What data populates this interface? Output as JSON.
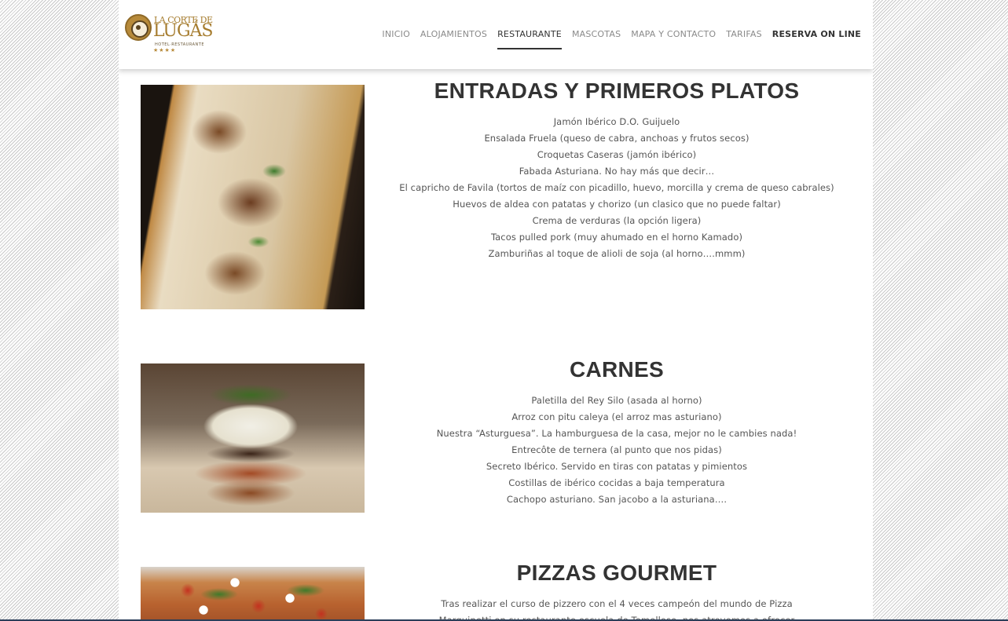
{
  "logo": {
    "line1": "LA CORTE DE",
    "line2": "LUGÁS",
    "line3": "HOTEL·RESTAURANTE",
    "stars": "★★★★"
  },
  "nav": {
    "items": [
      {
        "label": "INICIO"
      },
      {
        "label": "ALOJAMIENTOS"
      },
      {
        "label": "RESTAURANTE"
      },
      {
        "label": "MASCOTAS"
      },
      {
        "label": "MAPA Y CONTACTO"
      },
      {
        "label": "TARIFAS"
      },
      {
        "label": "RESERVA ON LINE"
      }
    ],
    "active": "RESTAURANTE"
  },
  "sections": [
    {
      "title": "ENTRADAS Y PRIMEROS PLATOS",
      "items": [
        "Jamón Ibérico D.O. Guijuelo",
        "Ensalada Fruela (queso de cabra, anchoas y frutos secos)",
        "Croquetas Caseras (jamón ibérico)",
        "Fabada Asturiana. No hay más que decir…",
        "El capricho de Favila (tortos de maíz con picadillo, huevo, morcilla y crema de queso cabrales)",
        "Huevos de aldea con patatas y chorizo (un clasico que no puede faltar)",
        "Crema de verduras (la opción ligera)",
        "Tacos pulled pork (muy ahumado en el horno Kamado)",
        "Zamburiñas al toque de alioli de soja (al horno….mmm)"
      ]
    },
    {
      "title": "CARNES",
      "items": [
        "Paletilla del Rey Silo (asada al horno)",
        "Arroz con pitu caleya (el arroz mas asturiano)",
        "Nuestra “Asturguesa”. La hamburguesa de la casa, mejor no le cambies nada!",
        "Entrecôte de ternera (al punto que nos pidas)",
        "Secreto Ibérico. Servido en tiras con patatas y pimientos",
        "Costillas de ibérico cocidas a baja temperatura",
        "Cachopo asturiano. San jacobo a la asturiana…."
      ]
    },
    {
      "title": "PIZZAS GOURMET",
      "items": [
        "Tras realizar el curso de pizzero con el 4 veces campeón del mundo de Pizza",
        "Marquinetti en su restaurante escuela de Tomelloso, nos atrevemos a ofrecer"
      ]
    }
  ]
}
